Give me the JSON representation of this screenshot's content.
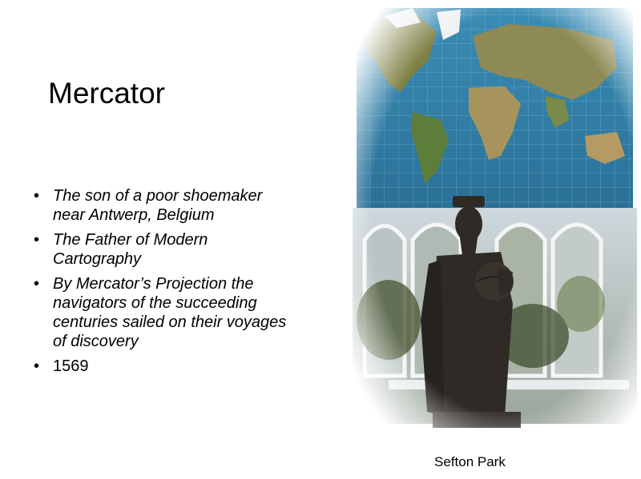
{
  "slide": {
    "title": "Mercator",
    "bullets": [
      {
        "text": "The son of a poor shoemaker near Antwerp, Belgium",
        "italic": true
      },
      {
        "text": "The Father of Modern Cartography",
        "italic": true
      },
      {
        "text": "By Mercator’s Projection the navigators of the succeeding centuries sailed on their voyages of discovery",
        "italic": true
      },
      {
        "text": "1569",
        "italic": false
      }
    ],
    "bullet_symbol": "•",
    "caption": "Sefton Park"
  },
  "colors": {
    "ocean": "#2f7fa8",
    "land": "#8a8a4a",
    "statue": "#2e2a26",
    "sky": "#dfe6ea"
  }
}
